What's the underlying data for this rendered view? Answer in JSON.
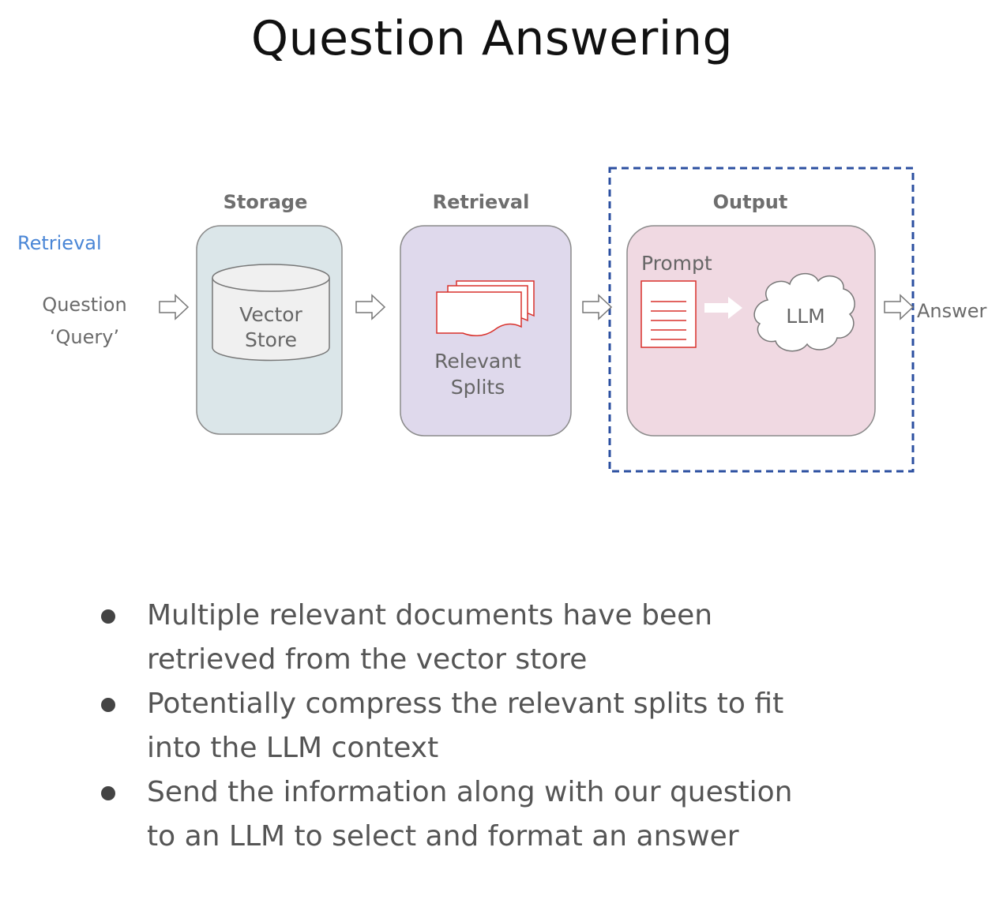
{
  "title": "Question Answering",
  "diagram": {
    "retrieval_tag": "Retrieval",
    "question_label": "Question",
    "query_label": "‘Query’",
    "sections": {
      "storage": {
        "title": "Storage",
        "item_line1": "Vector",
        "item_line2": "Store",
        "color": "#dbe6e9"
      },
      "retrieval": {
        "title": "Retrieval",
        "item_line1": "Relevant",
        "item_line2": "Splits",
        "color": "#dfd9ec"
      },
      "output": {
        "title": "Output",
        "prompt_label": "Prompt",
        "llm_label": "LLM",
        "color": "#f0d9e2"
      }
    },
    "answer_label": "Answer",
    "highlight_color": "#2b4fa0",
    "doc_color": "#d9312b"
  },
  "bullets": [
    {
      "line1": "Multiple relevant documents have been",
      "line2": "retrieved from the vector store"
    },
    {
      "line1": "Potentially compress the relevant splits to fit",
      "line2": "into the LLM context"
    },
    {
      "line1": "Send the information along with our question",
      "line2": "to an LLM to select and format an answer"
    }
  ]
}
